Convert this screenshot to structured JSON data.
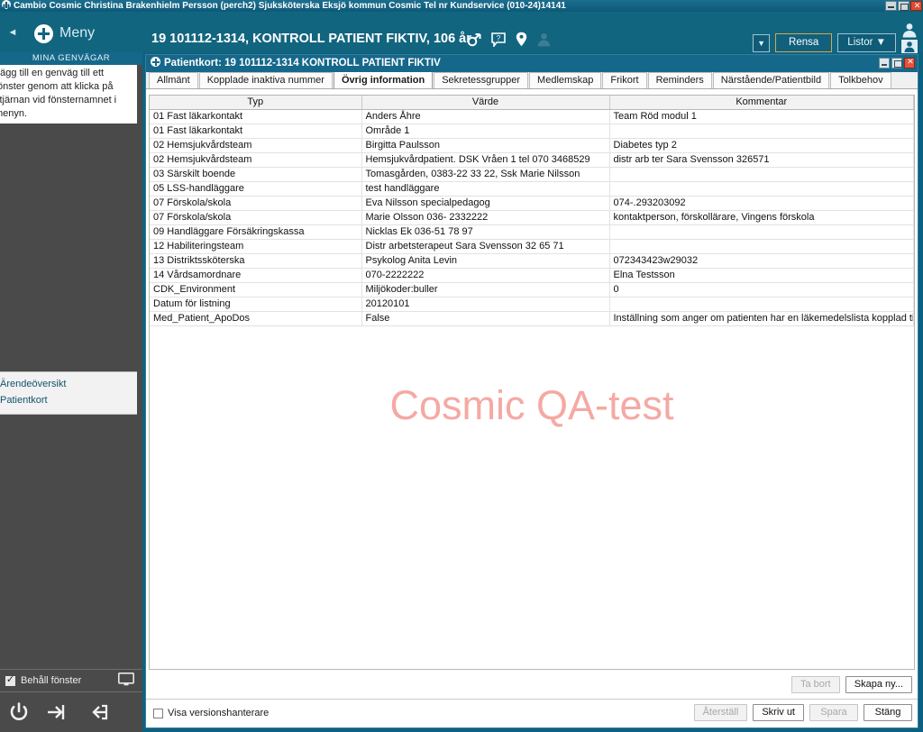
{
  "os_titlebar": {
    "title": "Cambio Cosmic  Christina Brakenhielm Persson (perch2) Sjuksköterska Eksjö kommun  Cosmic Tel nr  Kundservice (010-24)14141",
    "minimize": "–",
    "maximize": "□",
    "close": "✕"
  },
  "header": {
    "collapse_label": "◄",
    "menu_label": "Meny",
    "patient_banner": "19 101112-1314,  KONTROLL PATIENT FIKTIV,  106 år",
    "dropdown_label": "▼",
    "rensa_label": "Rensa",
    "listor_label": "Listor ▼",
    "accent_blue": "#12657f",
    "rensa_border": "#d5a84a"
  },
  "sidebar": {
    "shortcuts_title": "MINA GENVÄGAR",
    "shortcuts_text": "Lägg till en genväg till ett fönster genom att klicka på stjärnan vid fönsternamnet i menyn.",
    "links": [
      {
        "label": "Ärendeöversikt"
      },
      {
        "label": "Patientkort"
      }
    ],
    "keep_window_label": "Behåll fönster",
    "background": "#4a4a4a"
  },
  "window": {
    "title": "Patientkort: 19 101112-1314 KONTROLL PATIENT FIKTIV",
    "minimize": "–",
    "maximize": "□",
    "close": "✕",
    "tabs": [
      {
        "label": "Allmänt",
        "active": false
      },
      {
        "label": "Kopplade inaktiva nummer",
        "active": false
      },
      {
        "label": "Övrig information",
        "active": true
      },
      {
        "label": "Sekretessgrupper",
        "active": false
      },
      {
        "label": "Medlemskap",
        "active": false
      },
      {
        "label": "Frikort",
        "active": false
      },
      {
        "label": "Reminders",
        "active": false
      },
      {
        "label": "Närstående/Patientbild",
        "active": false
      },
      {
        "label": "Tolkbehov",
        "active": false
      }
    ],
    "watermark": "Cosmic QA-test",
    "watermark_color": "#f5a9a3"
  },
  "table": {
    "columns": [
      "Typ",
      "Värde",
      "Kommentar"
    ],
    "rows": [
      {
        "typ": "01 Fast läkarkontakt",
        "varde": "Anders Åhre",
        "kommentar": "Team Röd modul 1"
      },
      {
        "typ": "01 Fast läkarkontakt",
        "varde": "Område 1",
        "kommentar": ""
      },
      {
        "typ": "02 Hemsjukvårdsteam",
        "varde": "Birgitta Paulsson",
        "kommentar": "Diabetes typ 2"
      },
      {
        "typ": "02 Hemsjukvårdsteam",
        "varde": "Hemsjukvårdpatient. DSK Vråen 1 tel 070 3468529",
        "kommentar": "distr arb ter Sara Svensson 326571"
      },
      {
        "typ": "03 Särskilt boende",
        "varde": "Tomasgården, 0383-22 33 22, Ssk Marie Nilsson",
        "kommentar": ""
      },
      {
        "typ": "05 LSS-handläggare",
        "varde": "test handläggare",
        "kommentar": ""
      },
      {
        "typ": "07 Förskola/skola",
        "varde": "Eva Nilsson specialpedagog",
        "kommentar": "074-.293203092"
      },
      {
        "typ": "07 Förskola/skola",
        "varde": "Marie Olsson 036- 2332222",
        "kommentar": "kontaktperson, förskollärare, Vingens förskola"
      },
      {
        "typ": "09 Handläggare Försäkringskassa",
        "varde": "Nicklas Ek  036-51 78 97",
        "kommentar": ""
      },
      {
        "typ": "12 Habiliteringsteam",
        "varde": "Distr arbetsterapeut Sara Svensson 32 65 71",
        "kommentar": ""
      },
      {
        "typ": "13 Distriktssköterska",
        "varde": "Psykolog Anita Levin",
        "kommentar": "072343423w29032"
      },
      {
        "typ": "14 Vårdsamordnare",
        "varde": "070-2222222",
        "kommentar": "Elna Testsson"
      },
      {
        "typ": "CDK_Environment",
        "varde": "Miljökoder:buller",
        "kommentar": "0"
      },
      {
        "typ": "Datum för listning",
        "varde": "20120101",
        "kommentar": ""
      },
      {
        "typ": "Med_Patient_ApoDos",
        "varde": "False",
        "kommentar": "Inställning som anger om patienten har en läkemedelslista kopplad till Apodos"
      }
    ]
  },
  "actions": {
    "ta_bort": "Ta bort",
    "skapa_ny": "Skapa ny...",
    "visa_versionshanterare": "Visa versionshanterare",
    "aterstall": "Återställ",
    "skriv_ut": "Skriv ut",
    "spara": "Spara",
    "stang": "Stäng"
  }
}
